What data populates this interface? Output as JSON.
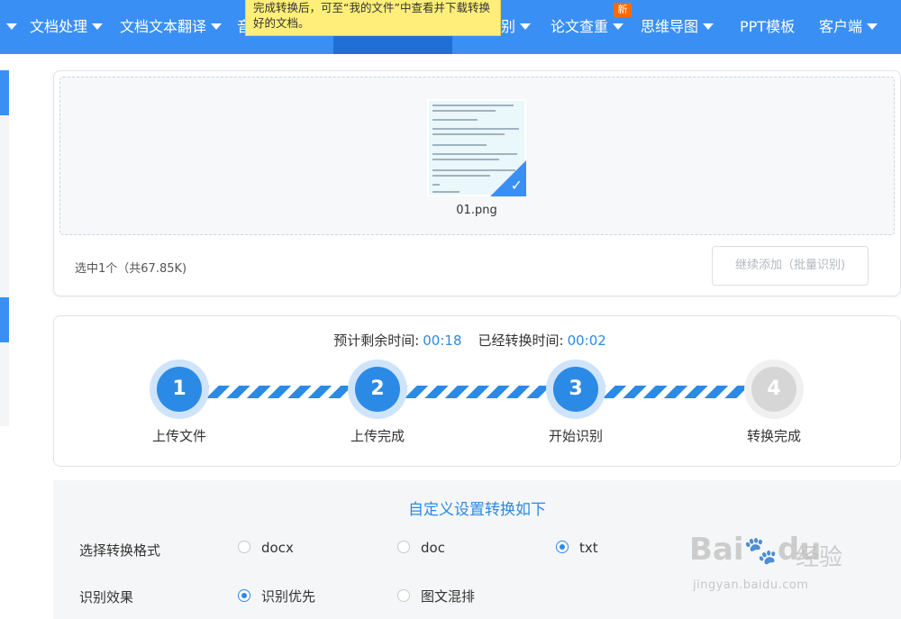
{
  "nav": {
    "items": [
      {
        "label": "",
        "caret": true
      },
      {
        "label": "文档处理",
        "caret": true
      },
      {
        "label": "文档文本翻译",
        "caret": true
      },
      {
        "label": "音",
        "caret": false
      },
      {
        "label": "别",
        "caret": true
      },
      {
        "label": "论文查重",
        "caret": true
      },
      {
        "label": "思维导图",
        "caret": true
      },
      {
        "label": "PPT模板",
        "caret": false
      },
      {
        "label": "客户端",
        "caret": true
      }
    ],
    "new_badge": "新",
    "tooltip": "完成转换后，可至“我的文件”中查看并下载转换好的文档。"
  },
  "upload": {
    "file_name": "01.png",
    "selection_info": "选中1个（共67.85K)",
    "add_more_label": "继续添加（批量识别)"
  },
  "progress": {
    "remaining_label": "预计剩余时间:",
    "remaining_value": "00:18",
    "elapsed_label": "已经转换时间:",
    "elapsed_value": "00:02",
    "steps": [
      {
        "number": "1",
        "label": "上传文件",
        "state": "done"
      },
      {
        "number": "2",
        "label": "上传完成",
        "state": "done"
      },
      {
        "number": "3",
        "label": "开始识别",
        "state": "active"
      },
      {
        "number": "4",
        "label": "转换完成",
        "state": "pending"
      }
    ]
  },
  "settings": {
    "title": "自定义设置转换如下",
    "format_label": "选择转换格式",
    "formats": [
      {
        "label": "docx",
        "checked": false
      },
      {
        "label": "doc",
        "checked": false
      },
      {
        "label": "txt",
        "checked": true
      }
    ],
    "effect_label": "识别效果",
    "effects": [
      {
        "label": "识别优先",
        "checked": true
      },
      {
        "label": "图文混排",
        "checked": false
      }
    ]
  },
  "colors": {
    "brand": "#3a8ff4",
    "accent": "#2b8ae5",
    "pending": "#d6d6d6"
  }
}
